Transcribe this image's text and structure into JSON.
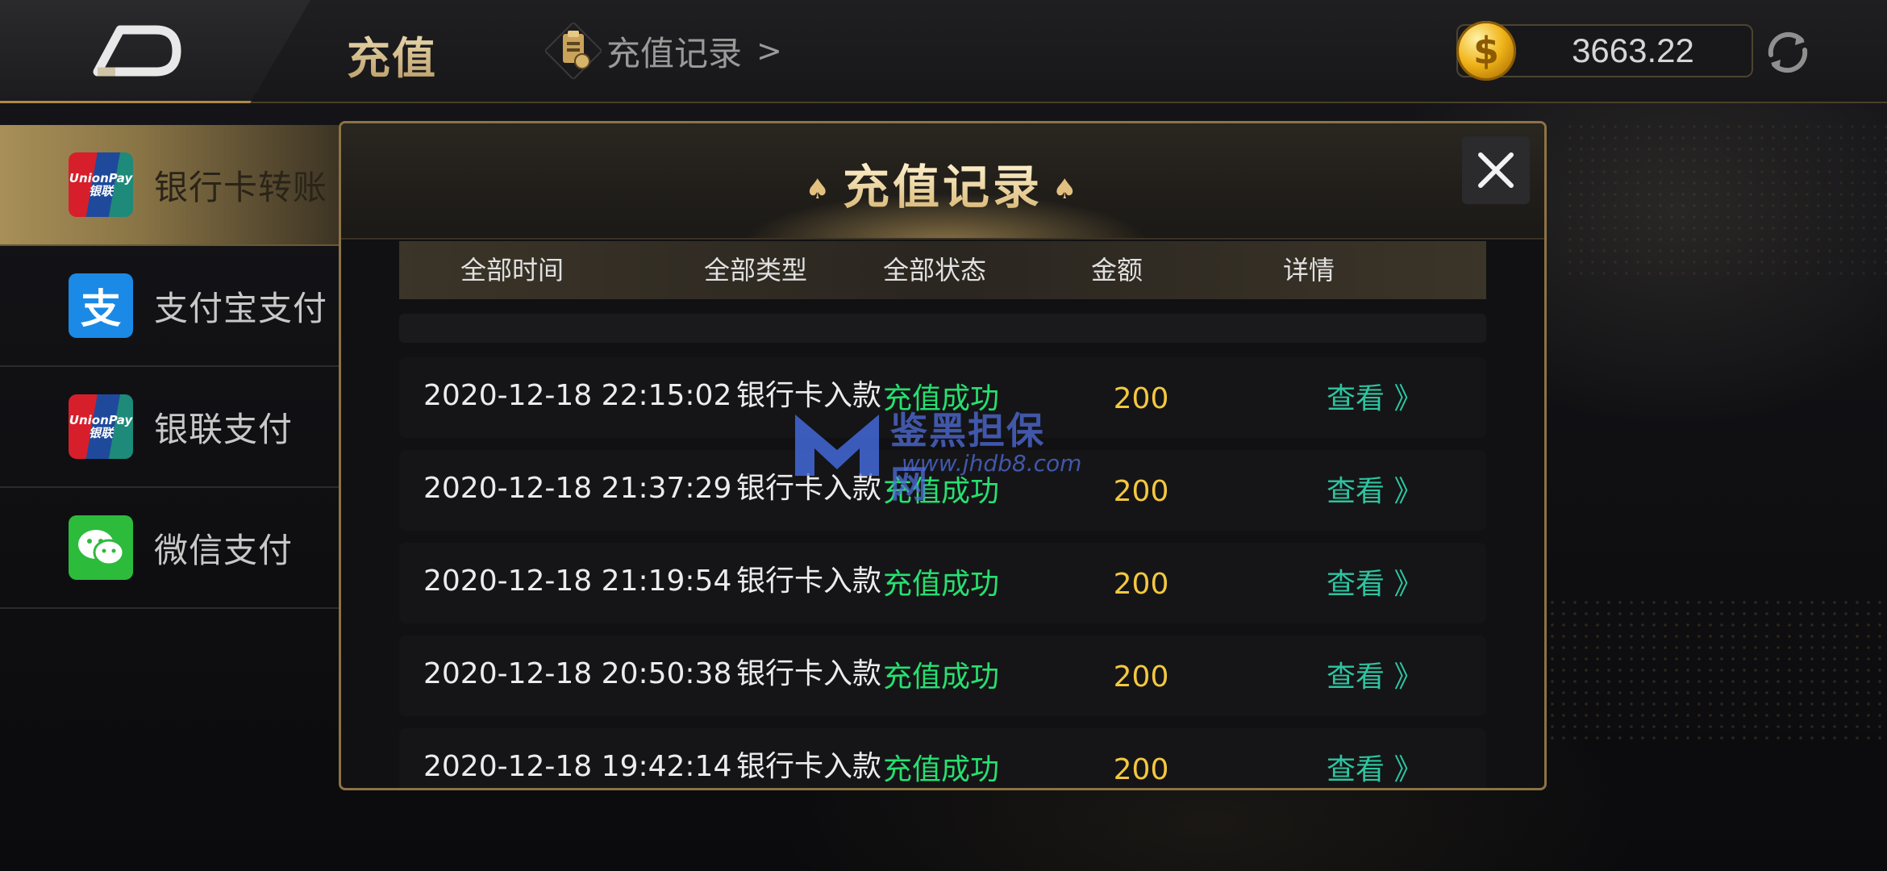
{
  "header": {
    "title": "充值",
    "record_link": "充值记录",
    "record_chevron": ">",
    "balance": "3663.22",
    "coin_symbol": "$"
  },
  "sidebar": {
    "items": [
      {
        "label": "银行卡转账",
        "icon": "unionpay-icon",
        "active": true
      },
      {
        "label": "支付宝支付",
        "icon": "alipay-icon",
        "active": false
      },
      {
        "label": "银联支付",
        "icon": "unionpay-icon",
        "active": false
      },
      {
        "label": "微信支付",
        "icon": "wechat-icon",
        "active": false
      }
    ],
    "unionpay_text": "UnionPay\n银联",
    "alipay_glyph": "支"
  },
  "modal": {
    "title": "充值记录",
    "spade": "♠",
    "close_symbol": "✕",
    "columns": [
      "全部时间",
      "全部类型",
      "全部状态",
      "金额",
      "详情"
    ],
    "rows": [
      {
        "time": "2020-12-18 22:15:02",
        "type": "银行卡入款",
        "status": "充值成功",
        "amount": "200",
        "detail": "查看 》"
      },
      {
        "time": "2020-12-18 21:37:29",
        "type": "银行卡入款",
        "status": "充值成功",
        "amount": "200",
        "detail": "查看 》"
      },
      {
        "time": "2020-12-18 21:19:54",
        "type": "银行卡入款",
        "status": "充值成功",
        "amount": "200",
        "detail": "查看 》"
      },
      {
        "time": "2020-12-18 20:50:38",
        "type": "银行卡入款",
        "status": "充值成功",
        "amount": "200",
        "detail": "查看 》"
      },
      {
        "time": "2020-12-18 19:42:14",
        "type": "银行卡入款",
        "status": "充值成功",
        "amount": "200",
        "detail": "查看 》"
      }
    ]
  },
  "watermark": {
    "text": "鉴黑担保网",
    "url": "www.jhdb8.com"
  },
  "colors": {
    "accent_gold": "#b08a45",
    "status_success": "#27e070",
    "amount_yellow": "#f3c840",
    "detail_link": "#2ec4a0"
  }
}
